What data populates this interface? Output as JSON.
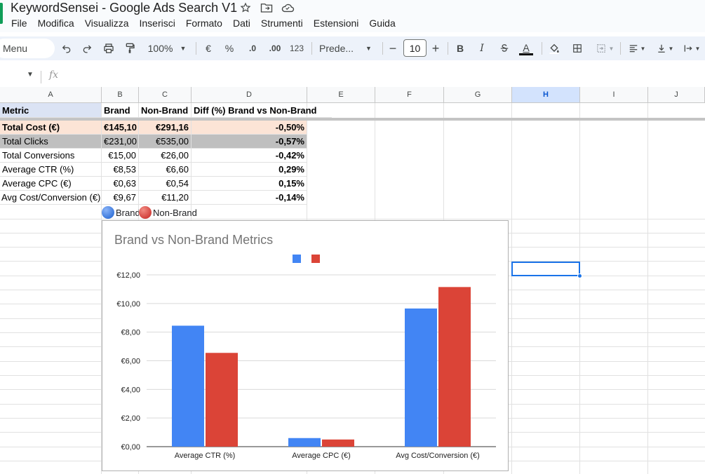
{
  "doc": {
    "title": "KeywordSensei - Google Ads Search V1"
  },
  "menu": [
    "File",
    "Modifica",
    "Visualizza",
    "Inserisci",
    "Formato",
    "Dati",
    "Strumenti",
    "Estensioni",
    "Guida"
  ],
  "toolbar": {
    "search_label": "Menu",
    "zoom": "100%",
    "currency": "€",
    "percent": "%",
    "dec_decrease": ".0",
    "dec_increase": ".00",
    "number_format": "123",
    "font": "Prede...",
    "font_size": "10",
    "bold": "B",
    "italic": "I",
    "text_color": "A"
  },
  "formula": {
    "fx": "fx"
  },
  "columns": [
    "A",
    "B",
    "C",
    "D",
    "E",
    "F",
    "G",
    "H",
    "I",
    "J"
  ],
  "active_column": "H",
  "table": {
    "header": [
      "Metric",
      "Brand",
      "Non-Brand",
      "Diff (%) Brand vs Non-Brand"
    ],
    "rows": [
      [
        "Total Cost (€)",
        "€145,10",
        "€291,16",
        "-0,50%"
      ],
      [
        "Total Clicks",
        "€231,00",
        "€535,00",
        "-0,57%"
      ],
      [
        "Total Conversions",
        "€15,00",
        "€26,00",
        "-0,42%"
      ],
      [
        "Average CTR (%)",
        "€8,53",
        "€6,60",
        "0,29%"
      ],
      [
        "Average CPC (€)",
        "€0,63",
        "€0,54",
        "0,15%"
      ],
      [
        "Avg Cost/Conversion (€)",
        "€9,67",
        "€11,20",
        "-0,14%"
      ]
    ],
    "legend_brand": "Brand",
    "legend_nonbrand": "Non-Brand"
  },
  "colors": {
    "brand": "#4285f4",
    "nonbrand": "#db4437",
    "header_bg": "#dbe3f4",
    "cost_bg": "#fce4d6",
    "clicks_bg": "#bfbfbf"
  },
  "chart_data": {
    "type": "bar",
    "title": "Brand vs Non-Brand Metrics",
    "categories": [
      "Average CTR (%)",
      "Average CPC (€)",
      "Avg Cost/Conversion (€)"
    ],
    "series": [
      {
        "name": "",
        "color": "#4285f4",
        "values": [
          8.45,
          0.6,
          9.65
        ]
      },
      {
        "name": "",
        "color": "#db4437",
        "values": [
          6.55,
          0.5,
          11.15
        ]
      }
    ],
    "yticks": [
      "€0,00",
      "€2,00",
      "€4,00",
      "€6,00",
      "€8,00",
      "€10,00",
      "€12,00"
    ],
    "ylim": [
      0,
      12
    ],
    "legend_position": "top",
    "grid": true
  }
}
